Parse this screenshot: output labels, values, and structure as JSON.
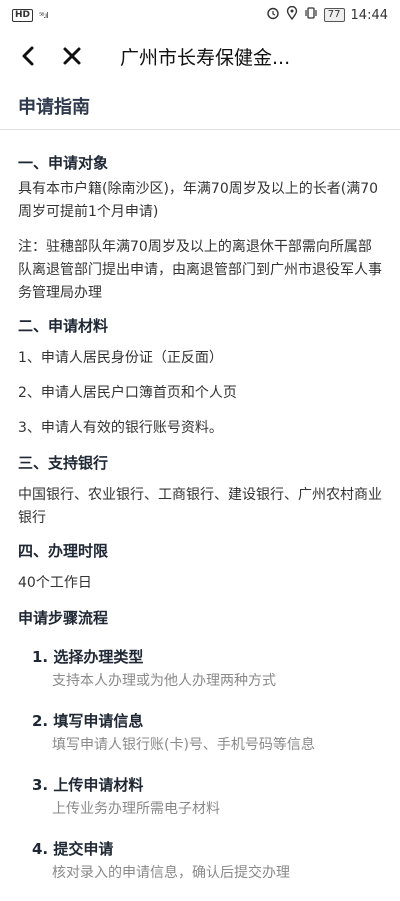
{
  "status_bar": {
    "network_badge": "HD",
    "signal": "⁵⁶.ıl",
    "battery": "77",
    "time": "14:44"
  },
  "nav": {
    "back_icon": "back-chevron",
    "close_icon": "close-x",
    "title": "广州市长寿保健金..."
  },
  "section_title": "申请指南",
  "sections": [
    {
      "heading": "一、申请对象",
      "paragraphs": [
        "具有本市户籍(除南沙区)，年满70周岁及以上的长者(满70周岁可提前1个月申请)",
        "注：驻穗部队年满70周岁及以上的离退休干部需向所属部队离退管部门提出申请，由离退管部门到广州市退役军人事务管理局办理"
      ]
    },
    {
      "heading": "二、申请材料",
      "paragraphs": [
        "1、申请人居民身份证（正反面）",
        "2、申请人居民户口簿首页和个人页",
        "3、申请人有效的银行账号资料。"
      ]
    },
    {
      "heading": "三、支持银行",
      "paragraphs": [
        "中国银行、农业银行、工商银行、建设银行、广州农村商业银行"
      ]
    },
    {
      "heading": "四、办理时限",
      "paragraphs": [
        "40个工作日"
      ]
    }
  ],
  "steps_heading": "申请步骤流程",
  "steps": [
    {
      "title": "1. 选择办理类型",
      "desc": "支持本人办理或为他人办理两种方式"
    },
    {
      "title": "2. 填写申请信息",
      "desc": "填写申请人银行账(卡)号、手机号码等信息"
    },
    {
      "title": "3. 上传申请材料",
      "desc": "上传业务办理所需电子材料"
    },
    {
      "title": "4. 提交申请",
      "desc": "核对录入的申请信息，确认后提交办理"
    }
  ]
}
